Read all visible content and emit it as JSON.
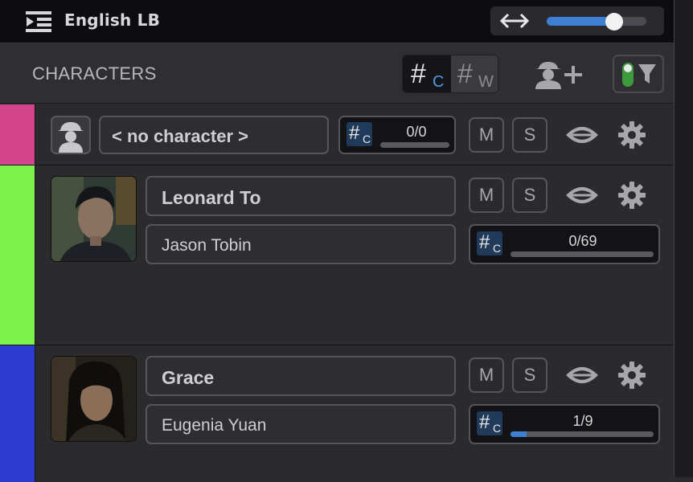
{
  "topbar": {
    "title": "English LB",
    "menu_icon": "menu-collapse-icon",
    "zoom_icon": "horizontal-resize-icon",
    "zoom_level": 0.68
  },
  "header": {
    "title": "CHARACTERS",
    "count_toggle": {
      "active": {
        "symbol": "#",
        "sub": "C"
      },
      "inactive": {
        "symbol": "#",
        "sub": "W"
      }
    },
    "add_icon": "add-character-icon",
    "filter_icon": "filter-toggle-icon"
  },
  "rows": [
    {
      "color": "#d3458d",
      "name": "< no character >",
      "actor": "",
      "counter": {
        "symbol": "#",
        "sub": "C",
        "text": "0/0",
        "progress": 0
      },
      "mute_label": "M",
      "solo_label": "S"
    },
    {
      "color": "#7ef24c",
      "name": "Leonard To",
      "actor": "Jason Tobin",
      "counter": {
        "symbol": "#",
        "sub": "C",
        "text": "0/69",
        "progress": 0
      },
      "mute_label": "M",
      "solo_label": "S"
    },
    {
      "color": "#2f3bd0",
      "name": "Grace",
      "actor": "Eugenia Yuan",
      "counter": {
        "symbol": "#",
        "sub": "C",
        "text": "1/9",
        "progress": 0.11
      },
      "mute_label": "M",
      "solo_label": "S"
    }
  ],
  "colors": {
    "accent": "#3d7fd1",
    "toggle_green": "#3c9a3c"
  }
}
